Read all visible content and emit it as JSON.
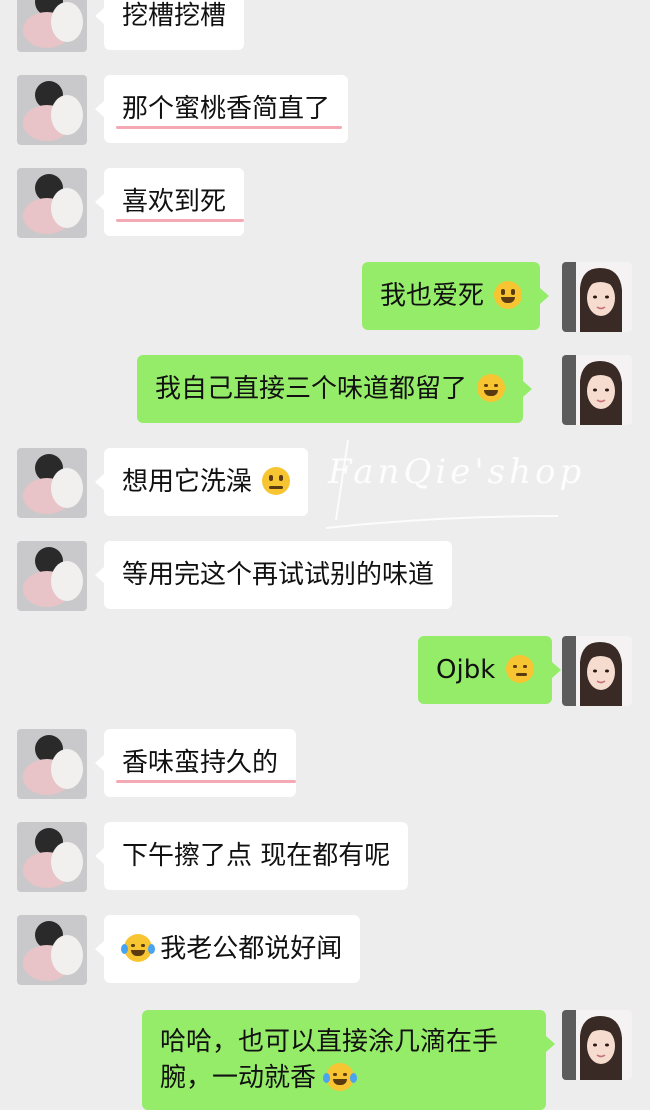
{
  "messages": [
    {
      "side": "left",
      "text": "挖槽挖槽"
    },
    {
      "side": "left",
      "text": "那个蜜桃香简直了"
    },
    {
      "side": "left",
      "text": "喜欢到死"
    },
    {
      "side": "right",
      "text": "我也爱死"
    },
    {
      "side": "right",
      "text": "我自己直接三个味道都留了"
    },
    {
      "side": "left",
      "text": "想用它洗澡"
    },
    {
      "side": "left",
      "text": "等用完这个再试试别的味道"
    },
    {
      "side": "right",
      "text": "Ojbk"
    },
    {
      "side": "left",
      "text": "香味蛮持久的"
    },
    {
      "side": "left",
      "text": "下午擦了点 现在都有呢"
    },
    {
      "side": "left",
      "text": "我老公都说好闻"
    },
    {
      "side": "right",
      "text": "哈哈，也可以直接涂几滴在手腕，一动就香"
    }
  ],
  "watermark": {
    "text": "FanQie'shop"
  },
  "colors": {
    "background": "#ededed",
    "incoming_bubble": "#ffffff",
    "outgoing_bubble": "#95ec69",
    "highlight_underline": "#f4a9b4"
  },
  "icons": {
    "grinning": "grinning-face-emoji",
    "squint": "squinting-face-emoji",
    "thinking": "thinking-face-emoji",
    "smirk": "smirking-face-emoji",
    "laughing": "tears-of-joy-emoji"
  }
}
